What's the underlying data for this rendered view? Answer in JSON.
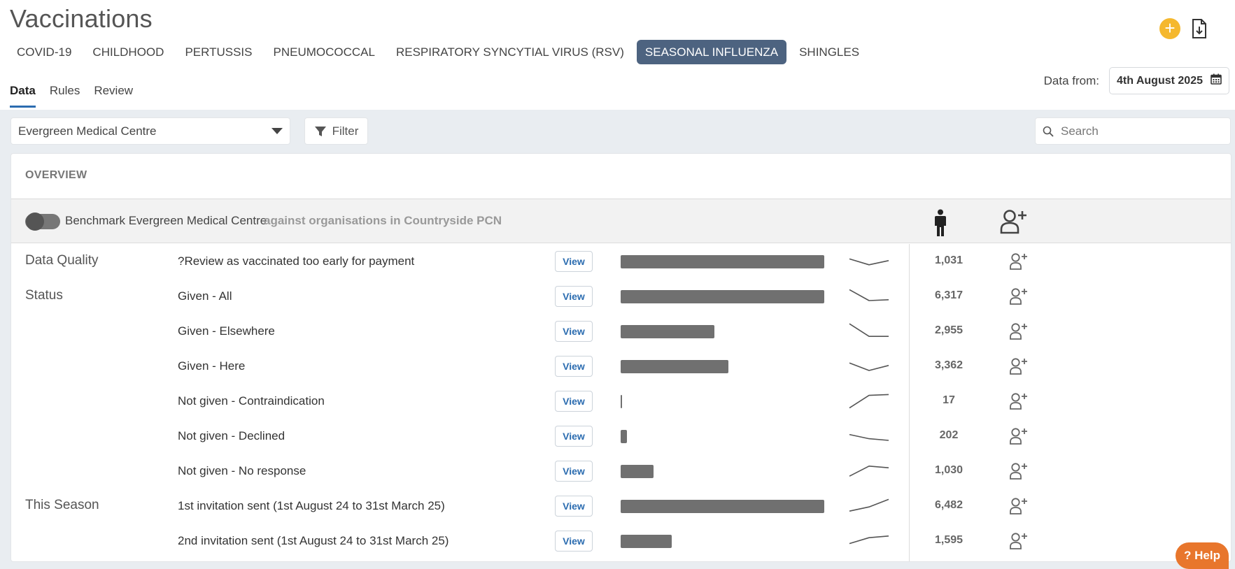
{
  "app": {
    "title": "Vaccinations"
  },
  "header": {
    "add_icon": "plus-icon",
    "export_icon": "download-file-icon"
  },
  "vaccine_tabs": [
    {
      "label": "COVID-19",
      "active": false
    },
    {
      "label": "CHILDHOOD",
      "active": false
    },
    {
      "label": "PERTUSSIS",
      "active": false
    },
    {
      "label": "PNEUMOCOCCAL",
      "active": false
    },
    {
      "label": "RESPIRATORY SYNCYTIAL VIRUS (RSV)",
      "active": false
    },
    {
      "label": "SEASONAL INFLUENZA",
      "active": true
    },
    {
      "label": "SHINGLES",
      "active": false
    }
  ],
  "sub_tabs": [
    {
      "label": "Data",
      "active": true
    },
    {
      "label": "Rules",
      "active": false
    },
    {
      "label": "Review",
      "active": false
    }
  ],
  "date": {
    "label": "Data from:",
    "value": "4th August 2025",
    "icon": "calendar-icon"
  },
  "toolbar": {
    "organisation": "Evergreen Medical Centre",
    "filter_label": "Filter",
    "search_placeholder": "Search"
  },
  "overview": {
    "title": "OVERVIEW",
    "benchmark_label": "Benchmark Evergreen Medical Centre",
    "benchmark_sub": "against organisations in Countryside PCN",
    "benchmark_on": false
  },
  "view_label": "View",
  "rows": [
    {
      "group": "Data Quality",
      "label": "?Review as vaccinated too early for payment",
      "count": "1,031",
      "bar": 1.0,
      "trend": [
        0.65,
        0.3,
        0.55
      ]
    },
    {
      "group": "Status",
      "label": "Given - All",
      "count": "6,317",
      "bar": 1.0,
      "trend": [
        0.9,
        0.25,
        0.3
      ]
    },
    {
      "group": "",
      "label": "Given - Elsewhere",
      "count": "2,955",
      "bar": 0.46,
      "trend": [
        0.95,
        0.2,
        0.2
      ]
    },
    {
      "group": "",
      "label": "Given - Here",
      "count": "3,362",
      "bar": 0.53,
      "trend": [
        0.7,
        0.25,
        0.55
      ]
    },
    {
      "group": "",
      "label": "Not given - Contraindication",
      "count": "17",
      "bar": 0.003,
      "trend": [
        0.1,
        0.85,
        0.9
      ]
    },
    {
      "group": "",
      "label": "Not given - Declined",
      "count": "202",
      "bar": 0.03,
      "trend": [
        0.6,
        0.35,
        0.25
      ]
    },
    {
      "group": "",
      "label": "Not given - No response",
      "count": "1,030",
      "bar": 0.16,
      "trend": [
        0.2,
        0.8,
        0.7
      ]
    },
    {
      "group": "This Season",
      "label": "1st invitation sent (1st August 24 to 31st March 25)",
      "count": "6,482",
      "bar": 1.0,
      "trend": [
        0.2,
        0.45,
        0.9
      ]
    },
    {
      "group": "",
      "label": "2nd invitation sent (1st August 24 to 31st March 25)",
      "count": "1,595",
      "bar": 0.25,
      "trend": [
        0.35,
        0.7,
        0.8
      ]
    }
  ],
  "help": {
    "label": "? Help"
  }
}
